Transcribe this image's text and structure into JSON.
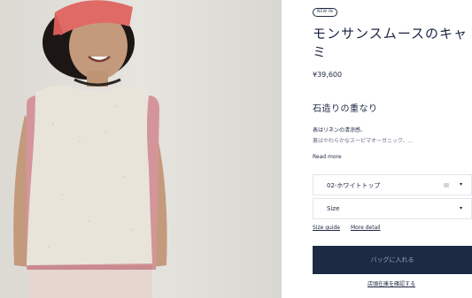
{
  "product": {
    "badge": "NEW IN",
    "title": "モンサンスムースのキャミ",
    "price": "¥39,600",
    "subtitle": "石造りの重なり",
    "description_lines": [
      "表はリネンの清涼感、",
      "裏はやわらかなスーピマオーガニック、..."
    ],
    "read_more": "Read more"
  },
  "options": {
    "color_value": "02-ホワイトトップ",
    "size_value": "Size"
  },
  "links": {
    "size_guide": "Size guide",
    "more_detail": "More detail"
  },
  "actions": {
    "add_to_cart": "バッグに入れる",
    "check_stock": "店頭在庫を確認する"
  },
  "colors": {
    "brand_navy": "#1d2a44",
    "photo_background": "#e3e1dc"
  },
  "icons": {
    "select_caret": "chevron-down-icon"
  }
}
